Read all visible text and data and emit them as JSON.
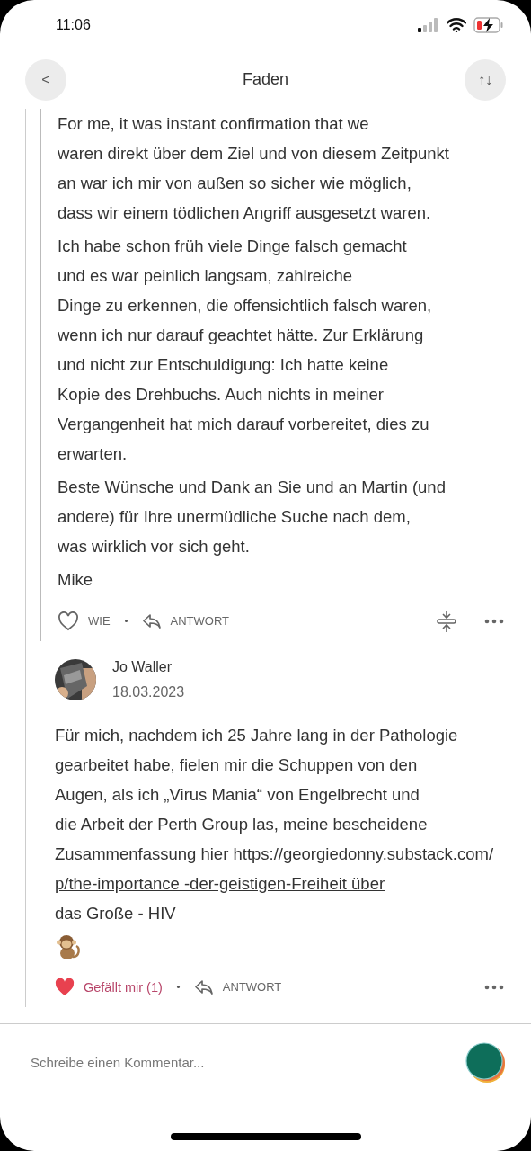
{
  "status_bar": {
    "time": "11:06"
  },
  "header": {
    "title": "Faden",
    "back": "<",
    "sort": "↑↓"
  },
  "comments": [
    {
      "kind": "reply",
      "liked": false,
      "like_label": "WIE",
      "reply_label": "ANTWORT",
      "paragraphs": [
        [
          {
            "kind": "text",
            "text": "For me, it was instant confirmation that we"
          },
          {
            "kind": "text",
            "text": "waren direkt über dem Ziel und von diesem Zeitpunkt"
          },
          {
            "kind": "text",
            "text": "an war ich mir von außen so sicher wie möglich,"
          },
          {
            "kind": "text",
            "text": "dass wir einem tödlichen Angriff ausgesetzt waren."
          }
        ],
        [
          {
            "kind": "text",
            "text": "Ich habe schon früh viele Dinge falsch gemacht"
          },
          {
            "kind": "text",
            "text": "und es war peinlich langsam, zahlreiche"
          },
          {
            "kind": "text",
            "text": "Dinge zu erkennen, die offensichtlich falsch waren,"
          },
          {
            "kind": "text",
            "text": "wenn ich nur darauf geachtet hätte. Zur Erklärung"
          },
          {
            "kind": "text",
            "text": "und nicht zur Entschuldigung: Ich hatte keine"
          },
          {
            "kind": "text",
            "text": "Kopie des Drehbuchs. Auch nichts in meiner"
          },
          {
            "kind": "text",
            "text": "Vergangenheit hat mich darauf vorbereitet, dies zu"
          },
          {
            "kind": "text",
            "text": "erwarten."
          }
        ],
        [
          {
            "kind": "text",
            "text": "Beste Wünsche und Dank an Sie und an Martin (und"
          },
          {
            "kind": "text",
            "text": "andere) für Ihre unermüdliche Suche nach dem,"
          },
          {
            "kind": "text",
            "text": "was wirklich vor sich geht."
          }
        ],
        [
          {
            "kind": "text",
            "text": "Mike"
          }
        ]
      ]
    },
    {
      "kind": "comment",
      "author": "Jo Waller",
      "date": "18.03.2023",
      "liked": true,
      "like_label": "Gefällt mir (1)",
      "reply_label": "ANTWORT",
      "paragraphs": [
        [
          {
            "kind": "text",
            "text": "Für mich, nachdem ich 25 Jahre lang in der Pathologie"
          },
          {
            "kind": "text",
            "text": "gearbeitet habe, fielen mir die Schuppen von den"
          },
          {
            "kind": "text",
            "text": "Augen, als ich „Virus Mania“ von Engelbrecht und"
          },
          {
            "kind": "text",
            "text": "die Arbeit der Perth Group las, meine bescheidene"
          },
          {
            "kind": "text",
            "text": "Zusammenfassung hier ",
            "link": "https://georgiedonny.substack.com/"
          },
          {
            "kind": "link",
            "link": "p/the-importance -der-geistigen-Freiheit über"
          },
          {
            "kind": "text",
            "text": "das Große - HIV"
          },
          {
            "kind": "emoji"
          }
        ]
      ]
    }
  ],
  "composer": {
    "placeholder": "Schreibe einen Kommentar..."
  }
}
